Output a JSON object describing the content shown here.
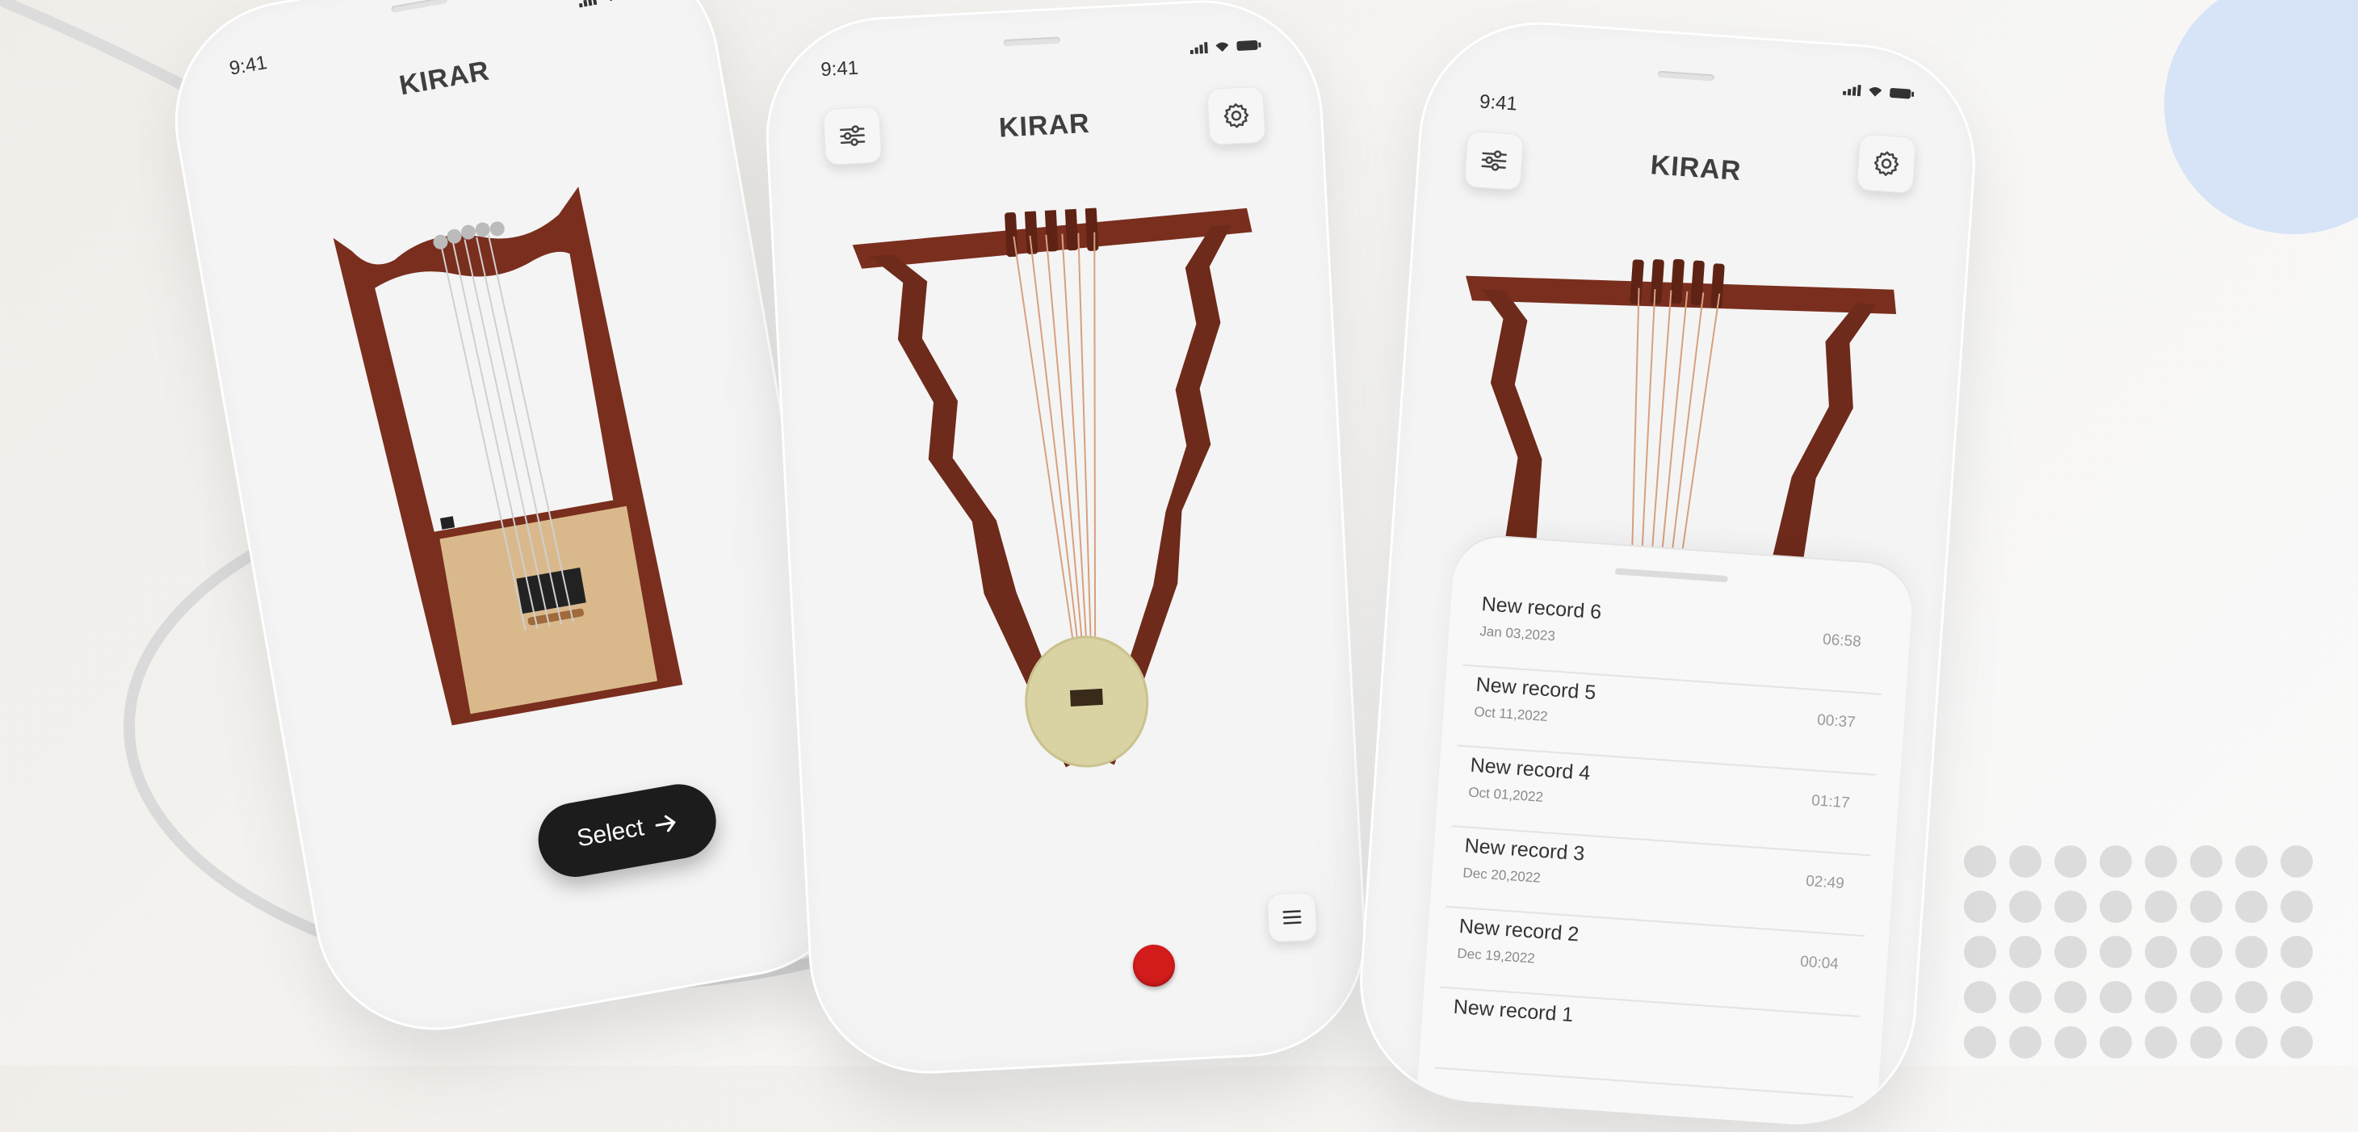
{
  "phones": [
    {
      "id": "phone-1",
      "status_time": "9:41",
      "app_title": "KIRAR",
      "select_button_label": "Select"
    },
    {
      "id": "phone-2",
      "status_time": "9:41",
      "app_title": "KIRAR"
    },
    {
      "id": "phone-3",
      "status_time": "9:41",
      "app_title": "KIRAR",
      "records": [
        {
          "name": "New record 6",
          "date": "Jan 03,2023",
          "duration": "06:58"
        },
        {
          "name": "New record 5",
          "date": "Oct 11,2022",
          "duration": "00:37"
        },
        {
          "name": "New record 4",
          "date": "Oct 01,2022",
          "duration": "01:17"
        },
        {
          "name": "New record 3",
          "date": "Dec 20,2022",
          "duration": "02:49"
        },
        {
          "name": "New record 2",
          "date": "Dec 19,2022",
          "duration": "00:04"
        },
        {
          "name": "New record 1",
          "date": "",
          "duration": ""
        }
      ]
    }
  ],
  "icons": {
    "filter": "sliders-icon",
    "settings": "gear-icon",
    "menu": "hamburger-menu-icon",
    "record": "record-button-icon",
    "arrow": "arrow-right-icon",
    "signal": "cellular-signal-icon",
    "wifi": "wifi-icon",
    "battery": "battery-icon"
  },
  "colors": {
    "record_red": "#d21b1b",
    "select_button": "#1c1c1c",
    "wood": "#7a2e1e",
    "accent_circle": "#d7e3f6"
  }
}
